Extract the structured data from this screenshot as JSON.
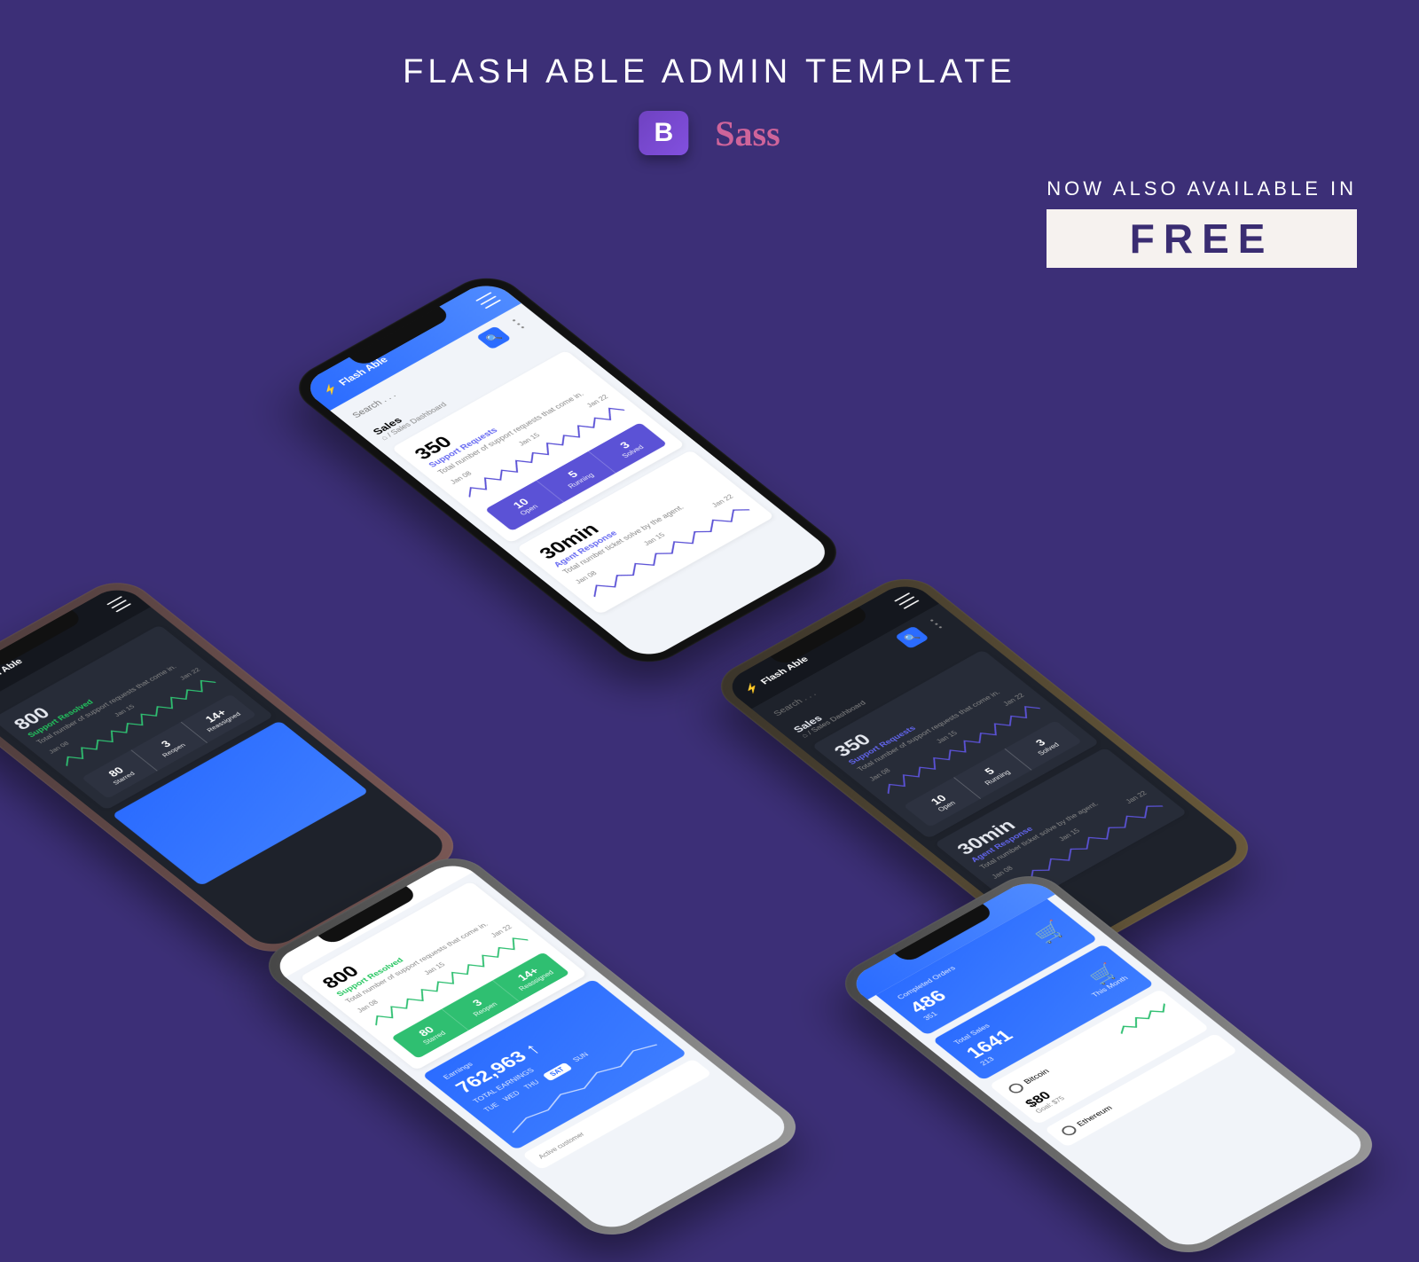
{
  "headline": "FLASH ABLE ADMIN TEMPLATE",
  "tech": {
    "bootstrap": "B",
    "sass": "Sass"
  },
  "promo": {
    "top": "NOW ALSO AVAILABLE IN",
    "free": "FREE"
  },
  "app": {
    "brand": "Flash Able",
    "search_placeholder": "Search . . .",
    "page_title": "Sales",
    "breadcrumb": "Sales Dashboard"
  },
  "dates": [
    "Jan 08",
    "Jan 15",
    "Jan 22"
  ],
  "support_requests": {
    "value": "350",
    "label": "Support Requests",
    "desc": "Total number of support requests that come in.",
    "stats": [
      {
        "n": "10",
        "l": "Open"
      },
      {
        "n": "5",
        "l": "Running"
      },
      {
        "n": "3",
        "l": "Solved"
      }
    ]
  },
  "agent_response": {
    "value": "30min",
    "label": "Agent Response",
    "desc": "Total number ticket solve by the agent."
  },
  "support_resolved": {
    "value": "800",
    "label": "Support Resolved",
    "desc": "Total number of support requests that come in.",
    "stats": [
      {
        "n": "80",
        "l": "Starred"
      },
      {
        "n": "3",
        "l": "Reopen"
      },
      {
        "n": "14+",
        "l": "Reassigned"
      }
    ]
  },
  "earnings": {
    "title": "Earnings",
    "value": "762,963",
    "sublabel": "TOTAL EARNINGS",
    "days": [
      "TUE",
      "WED",
      "THU",
      "SAT",
      "SUN"
    ],
    "active_day": "SAT",
    "active_customer": "Active customer"
  },
  "orders": {
    "completed_label": "Completed Orders",
    "completed_value": "486",
    "completed_sub": "351",
    "sales_label": "Total Sales",
    "sales_value": "1641",
    "sales_sub": "213",
    "this_month": "This Month"
  },
  "bitcoin": {
    "name": "Bitcoin",
    "value": "$80",
    "goal": "Goal: $75"
  },
  "ethereum": {
    "name": "Ethereum"
  }
}
